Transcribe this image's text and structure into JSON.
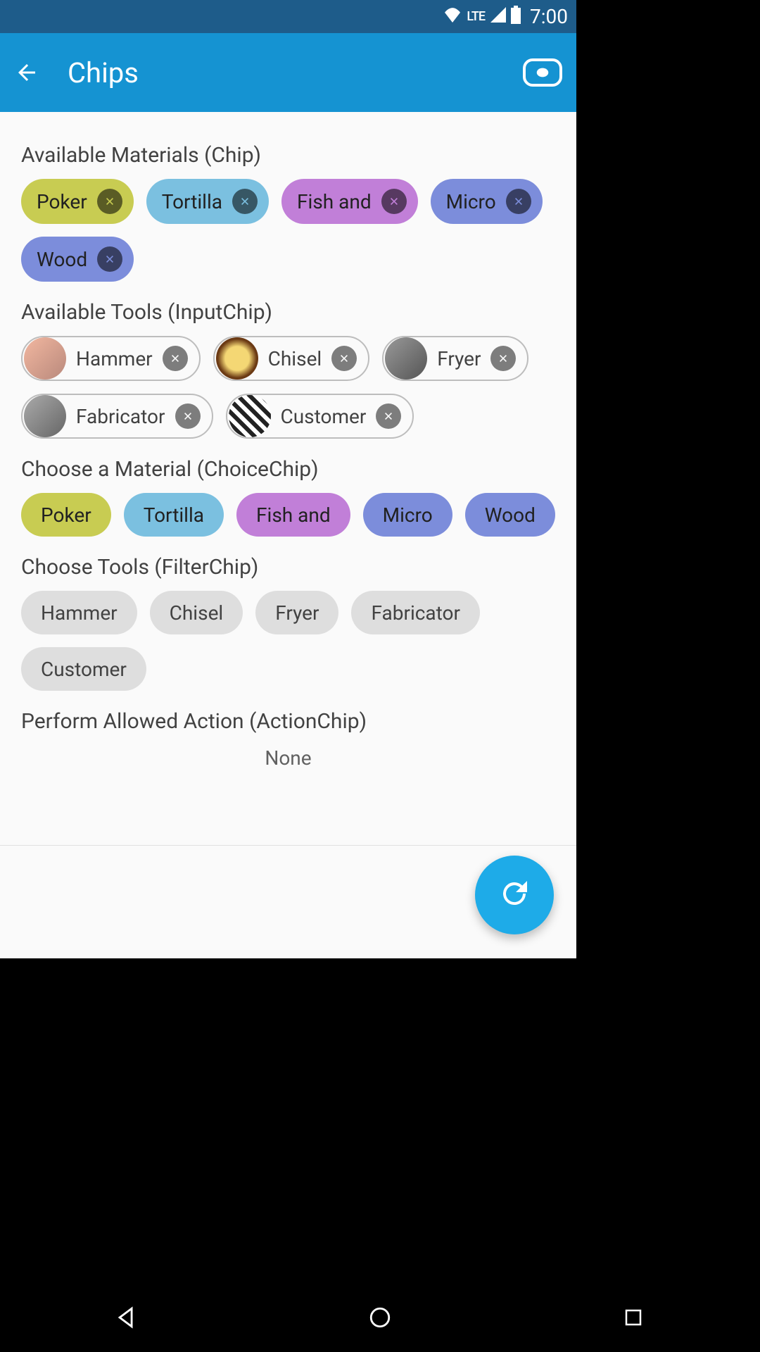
{
  "status_bar": {
    "lte_label": "LTE",
    "time": "7:00"
  },
  "app_bar": {
    "title": "Chips"
  },
  "sections": {
    "materials_title": "Available Materials (Chip)",
    "materials": [
      {
        "label": "Poker",
        "color_key": "poker"
      },
      {
        "label": "Tortilla",
        "color_key": "tortilla"
      },
      {
        "label": "Fish and",
        "color_key": "fishand"
      },
      {
        "label": "Micro",
        "color_key": "micro"
      },
      {
        "label": "Wood",
        "color_key": "wood"
      }
    ],
    "tools_title": "Available Tools (InputChip)",
    "tools": [
      {
        "label": "Hammer",
        "avatar_key": "hammer"
      },
      {
        "label": "Chisel",
        "avatar_key": "chisel"
      },
      {
        "label": "Fryer",
        "avatar_key": "fryer"
      },
      {
        "label": "Fabricator",
        "avatar_key": "fabricator"
      },
      {
        "label": "Customer",
        "avatar_key": "customer"
      }
    ],
    "choice_title": "Choose a Material (ChoiceChip)",
    "choices": [
      {
        "label": "Poker",
        "color_key": "poker"
      },
      {
        "label": "Tortilla",
        "color_key": "tortilla"
      },
      {
        "label": "Fish and",
        "color_key": "fishand"
      },
      {
        "label": "Micro",
        "color_key": "micro"
      },
      {
        "label": "Wood",
        "color_key": "wood"
      }
    ],
    "filter_title": "Choose Tools (FilterChip)",
    "filters": [
      {
        "label": "Hammer"
      },
      {
        "label": "Chisel"
      },
      {
        "label": "Fryer"
      },
      {
        "label": "Fabricator"
      },
      {
        "label": "Customer"
      }
    ],
    "action_title": "Perform Allowed Action (ActionChip)",
    "action_none": "None"
  },
  "colors": {
    "primary": "#1593d2",
    "status": "#1e5c8a",
    "fab": "#1eabe8"
  }
}
